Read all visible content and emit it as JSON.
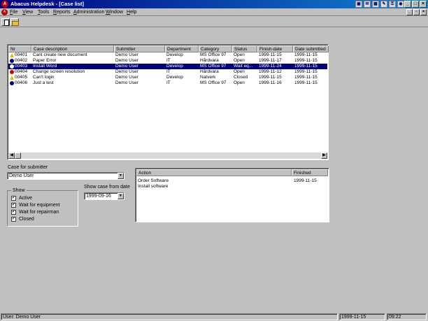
{
  "titlebar": {
    "title": "Abacus Helpdesk - [Case list]"
  },
  "menubar": {
    "items": [
      {
        "label": "File",
        "u": "F",
        "rest": "ile"
      },
      {
        "label": "View",
        "u": "V",
        "rest": "iew"
      },
      {
        "label": "Tools",
        "u": "T",
        "rest": "ools"
      },
      {
        "label": "Reports",
        "u": "R",
        "rest": "eports"
      },
      {
        "label": "Administration",
        "u": "A",
        "rest": "dministration"
      },
      {
        "label": "Window",
        "u": "W",
        "rest": "indow"
      },
      {
        "label": "Help",
        "u": "H",
        "rest": "elp"
      }
    ]
  },
  "case_list": {
    "columns": [
      "Nr",
      "Case description",
      "Submitter",
      "Department",
      "Category",
      "Status",
      "Finish-date",
      "Date submitted"
    ],
    "rows": [
      {
        "icon": "warning-icon",
        "nr": "00401",
        "desc": "Cant create new document",
        "submitter": "Demo User",
        "dept": "Develop",
        "category": "MS Office 97",
        "status": "Open",
        "finish": "1999-11-15",
        "submitted": "1999-11-15",
        "selected": false
      },
      {
        "icon": "info-icon",
        "nr": "00402",
        "desc": "Paper Error",
        "submitter": "Demo User",
        "dept": "IT",
        "category": "Hårdvara",
        "status": "Open",
        "finish": "1999-11-17",
        "submitted": "1999-11-15",
        "selected": false
      },
      {
        "icon": "info-icon",
        "nr": "00403",
        "desc": "Install Word",
        "submitter": "Demo User",
        "dept": "Develop",
        "category": "MS Office 97",
        "status": "Wait eq...",
        "finish": "1999-11-24",
        "submitted": "1999-11-15",
        "selected": true
      },
      {
        "icon": "error-icon",
        "nr": "00404",
        "desc": "Change screen resolution",
        "submitter": "Demo User",
        "dept": "IT",
        "category": "Hårdvara",
        "status": "Open",
        "finish": "1999-11-12",
        "submitted": "1999-11-15",
        "selected": false
      },
      {
        "icon": "warning-icon",
        "nr": "00405",
        "desc": "Can't login",
        "submitter": "Demo User",
        "dept": "Develop",
        "category": "Natverk",
        "status": "Closed",
        "finish": "1999-11-15",
        "submitted": "1999-11-15",
        "selected": false
      },
      {
        "icon": "info-icon",
        "nr": "00406",
        "desc": "Just a test",
        "submitter": "Demo User",
        "dept": "IT",
        "category": "MS Office 97",
        "status": "Open",
        "finish": "1999-11-16",
        "submitted": "1999-11-15",
        "selected": false
      }
    ]
  },
  "filters": {
    "submitter_label": "Case for submitter",
    "submitter_value": "Demo User",
    "show_label": "Show",
    "show_items": [
      {
        "label": "Active",
        "checked": true
      },
      {
        "label": "Wait for equipment",
        "checked": true
      },
      {
        "label": "Wait for repairman",
        "checked": true
      },
      {
        "label": "Closed",
        "checked": true
      }
    ],
    "date_label": "Show case from date",
    "date_value": "1999-09-16"
  },
  "actions": {
    "columns": [
      "Action",
      "Finished"
    ],
    "rows": [
      {
        "action": "Order Software",
        "finished": "1999-11-15"
      },
      {
        "action": "Install software",
        "finished": ""
      }
    ]
  },
  "statusbar": {
    "user": "User: Demo User",
    "date": "1999-11-15",
    "time": "09:22"
  }
}
